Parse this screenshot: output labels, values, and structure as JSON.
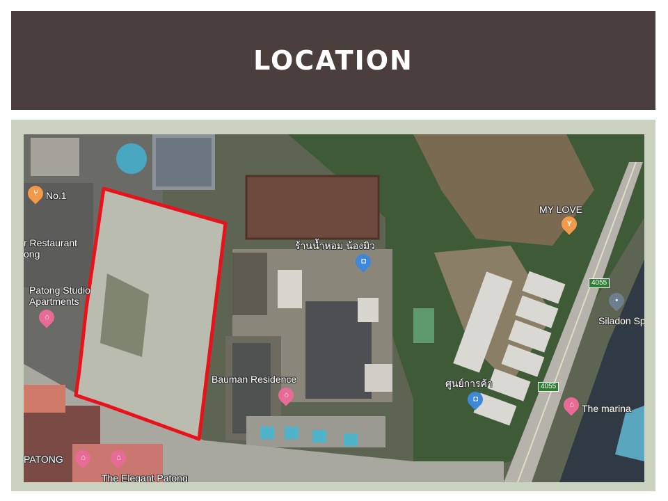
{
  "slide": {
    "title": "LOCATION"
  },
  "map": {
    "labels": {
      "no1": "No.1",
      "restaurant": "r Restaurant",
      "restaurant_line2": "ong",
      "studio": "Patong Studio",
      "studio_line2": "Apartments",
      "thai_shop": "ร้านน้ำหอม น้องมิว",
      "my_love": "MY LOVE",
      "siladon": "Siladon Sp",
      "bauman": "Bauman Residence",
      "shopping_center": "ศูนย์การค้า",
      "marina": "The marina",
      "patong": "PATONG",
      "elegant": "The Elegant Patong"
    },
    "road_numbers": {
      "upper": "4055",
      "lower": "4055"
    },
    "icons": {
      "no1": "restaurant-icon",
      "studio": "hotel-icon",
      "thai_shop": "shopping-icon",
      "my_love": "bar-icon",
      "siladon": "place-icon",
      "bauman": "hotel-icon",
      "shopping_center": "shopping-icon",
      "marina": "hotel-icon",
      "patong": "hotel-icon",
      "elegant": "hotel-icon"
    },
    "colors": {
      "boundary": "#e8121a",
      "title_band": "#4a3f3c",
      "frame": "#c9d3c0"
    }
  }
}
